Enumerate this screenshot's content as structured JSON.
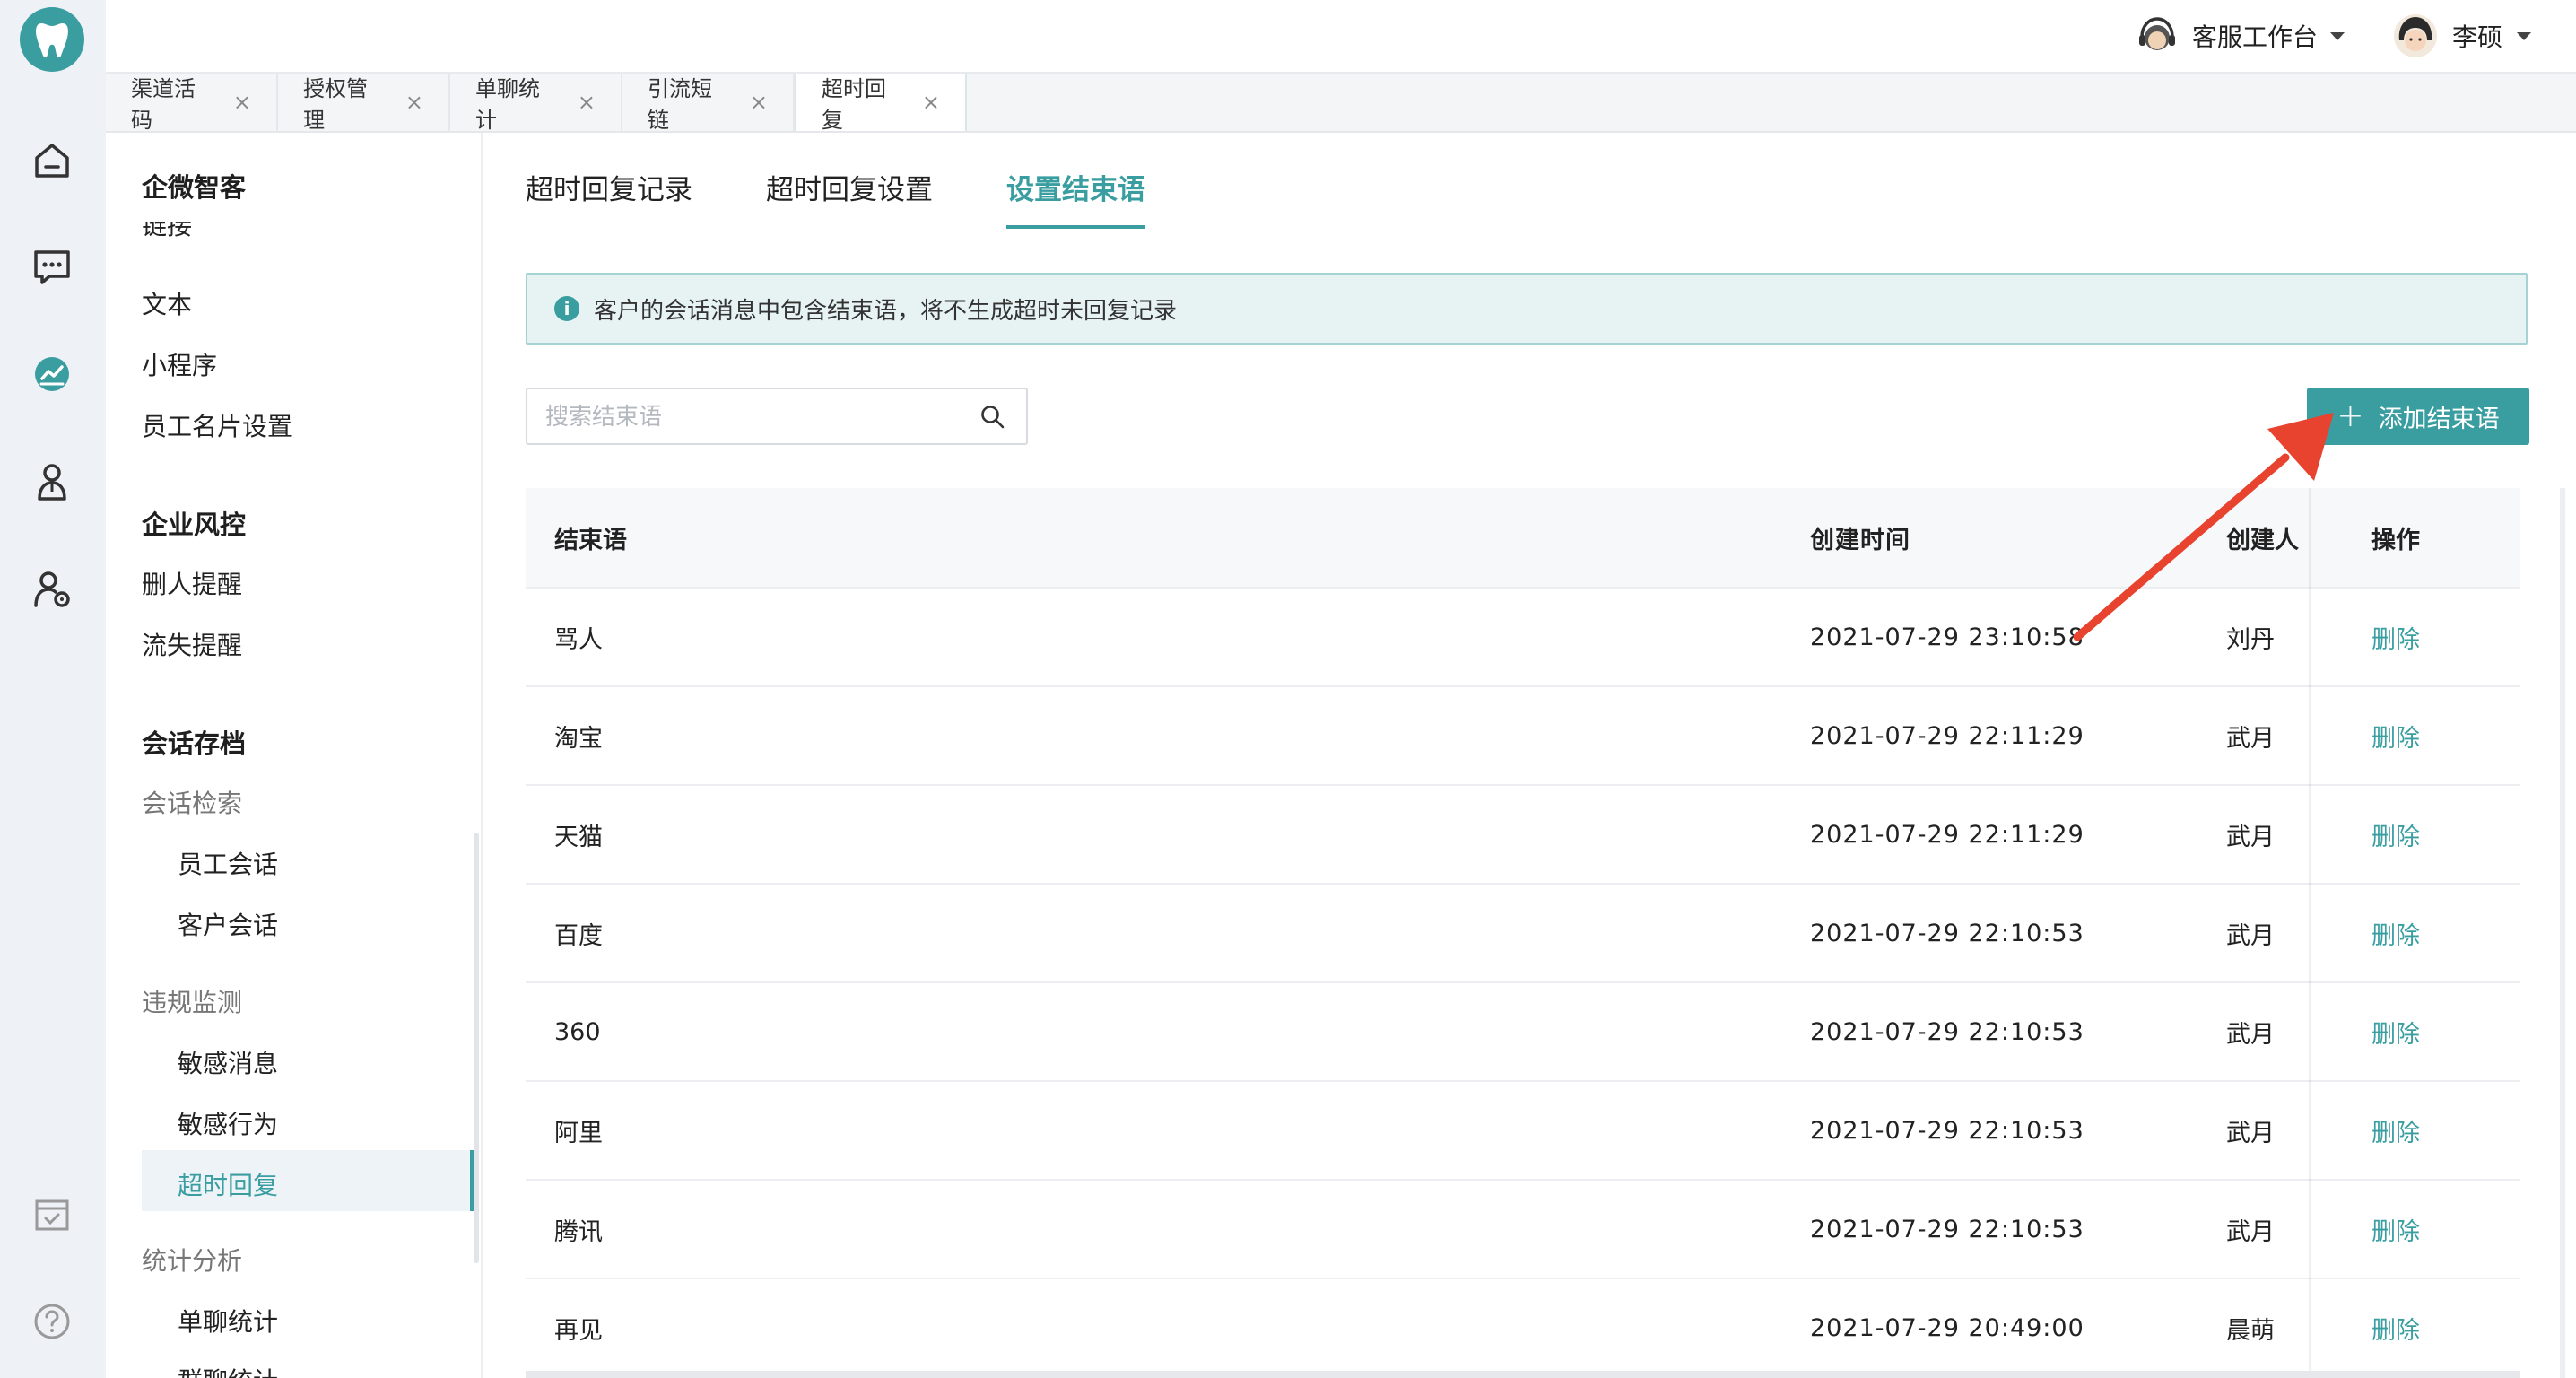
{
  "header": {
    "service_label": "客服工作台",
    "user_name": "李硕"
  },
  "tabs": [
    {
      "label": "渠道活码",
      "close": "×"
    },
    {
      "label": "授权管理",
      "close": "×"
    },
    {
      "label": "单聊统计",
      "close": "×"
    },
    {
      "label": "引流短链",
      "close": "×"
    },
    {
      "label": "超时回复",
      "close": "×"
    }
  ],
  "sidebar": {
    "title": "企微智客",
    "cut_item": "链接",
    "items_top": [
      "文本",
      "小程序",
      "员工名片设置"
    ],
    "section_risk": "企业风控",
    "risk_items": [
      "删人提醒",
      "流失提醒"
    ],
    "section_archive": "会话存档",
    "group_search": "会话检索",
    "search_items": [
      "员工会话",
      "客户会话"
    ],
    "group_violation": "违规监测",
    "violation_items": [
      "敏感消息",
      "敏感行为",
      "超时回复"
    ],
    "group_stats": "统计分析",
    "stats_items": [
      "单聊统计",
      "群聊统计"
    ]
  },
  "subtabs": [
    "超时回复记录",
    "超时回复设置",
    "设置结束语"
  ],
  "alert": {
    "text": "客户的会话消息中包含结束语，将不生成超时未回复记录"
  },
  "search": {
    "placeholder": "搜索结束语"
  },
  "add_button": {
    "label": "添加结束语"
  },
  "table": {
    "headers": [
      "结束语",
      "创建时间",
      "创建人",
      "操作"
    ],
    "rows": [
      {
        "phrase": "骂人",
        "time": "2021-07-29 23:10:58",
        "creator": "刘丹",
        "action": "删除"
      },
      {
        "phrase": "淘宝",
        "time": "2021-07-29 22:11:29",
        "creator": "武月",
        "action": "删除"
      },
      {
        "phrase": "天猫",
        "time": "2021-07-29 22:11:29",
        "creator": "武月",
        "action": "删除"
      },
      {
        "phrase": "百度",
        "time": "2021-07-29 22:10:53",
        "creator": "武月",
        "action": "删除"
      },
      {
        "phrase": "360",
        "time": "2021-07-29 22:10:53",
        "creator": "武月",
        "action": "删除"
      },
      {
        "phrase": "阿里",
        "time": "2021-07-29 22:10:53",
        "creator": "武月",
        "action": "删除"
      },
      {
        "phrase": "腾讯",
        "time": "2021-07-29 22:10:53",
        "creator": "武月",
        "action": "删除"
      },
      {
        "phrase": "再见",
        "time": "2021-07-29 20:49:00",
        "creator": "晨萌",
        "action": "删除"
      }
    ]
  },
  "colors": {
    "accent": "#3a9ea1",
    "annotation_arrow": "#e8432f"
  }
}
